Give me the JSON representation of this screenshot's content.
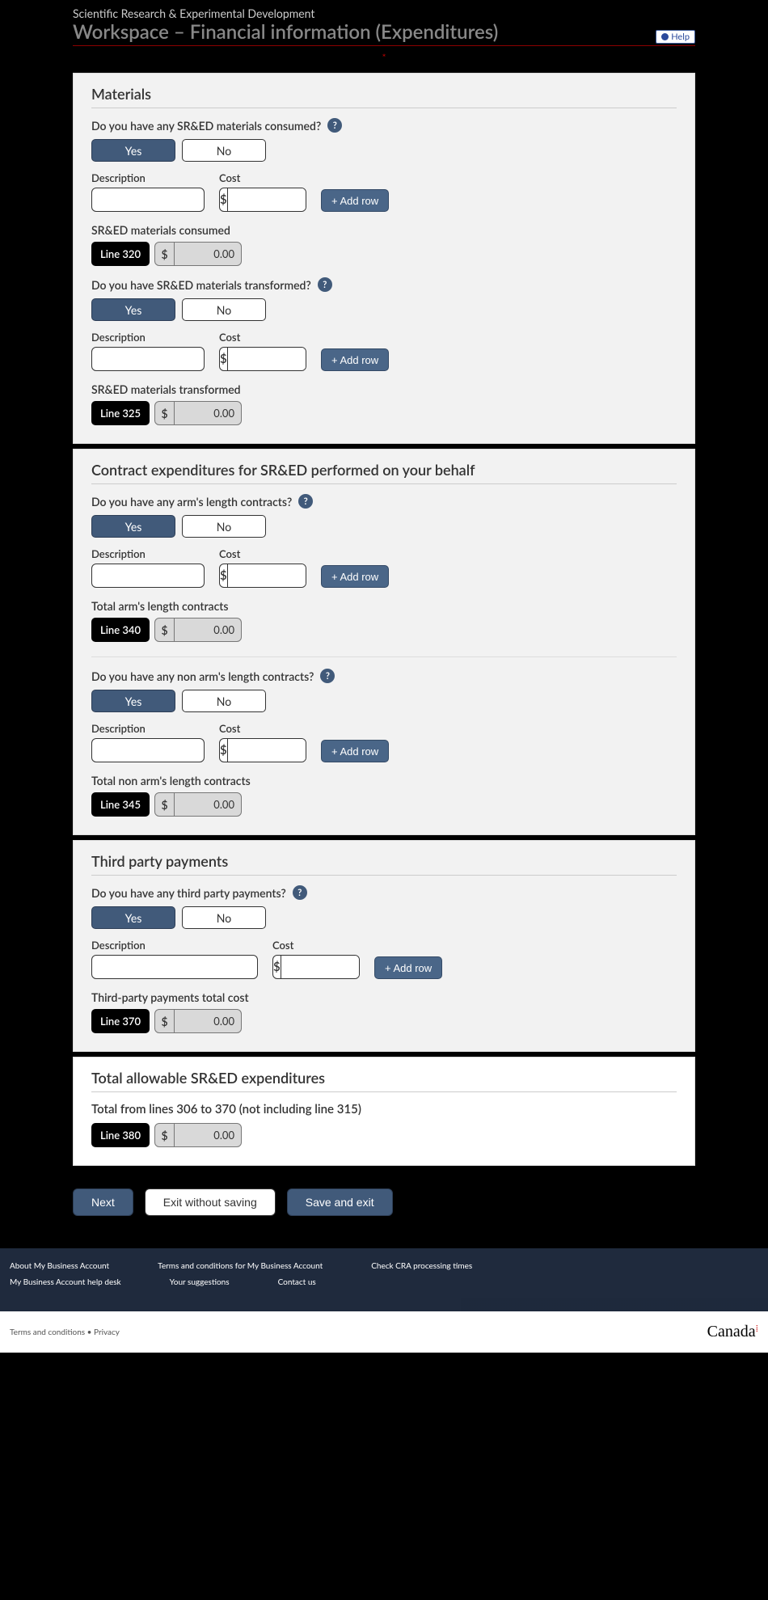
{
  "header": {
    "supertitle": "Scientific Research & Experimental Development",
    "title": "Workspace – Financial information (Expenditures)",
    "help": "Help",
    "star": "*"
  },
  "common": {
    "yes": "Yes",
    "no": "No",
    "description": "Description",
    "cost": "Cost",
    "dollar": "$",
    "add_row": "+ Add row",
    "zero": "0.00",
    "help_q": "?"
  },
  "materials": {
    "heading": "Materials",
    "q_consumed": "Do you have any SR&ED materials consumed?",
    "consumed_label": "SR&ED materials consumed",
    "line320": "Line 320",
    "q_transformed": "Do you have SR&ED materials transformed?",
    "transformed_label": "SR&ED materials transformed",
    "line325": "Line 325"
  },
  "contracts": {
    "heading": "Contract expenditures for SR&ED performed on your behalf",
    "q_arm": "Do you have any arm's length contracts?",
    "arm_total_label": "Total arm's length contracts",
    "line340": "Line 340",
    "q_nonarm": "Do you have any non arm's length contracts?",
    "nonarm_total_label": "Total non arm's length contracts",
    "line345": "Line 345"
  },
  "third_party": {
    "heading": "Third party payments",
    "q": "Do you have any third party payments?",
    "total_label": "Third-party payments total cost",
    "line370": "Line 370"
  },
  "total": {
    "heading": "Total allowable SR&ED expenditures",
    "label": "Total from lines 306 to 370 (not including line 315)",
    "line380": "Line 380"
  },
  "actions": {
    "next": "Next",
    "exit": "Exit without saving",
    "save": "Save and exit"
  },
  "footer1": {
    "r1c1": "About My Business Account",
    "r1c2": "Terms and conditions for My Business Account",
    "r1c3": "Check CRA processing times",
    "r2c1": "My Business Account help desk",
    "r2c2": "Your suggestions",
    "r2c3": "Contact us"
  },
  "footer2": {
    "left": "Terms and conditions  •  Privacy",
    "canada": "Canada"
  }
}
